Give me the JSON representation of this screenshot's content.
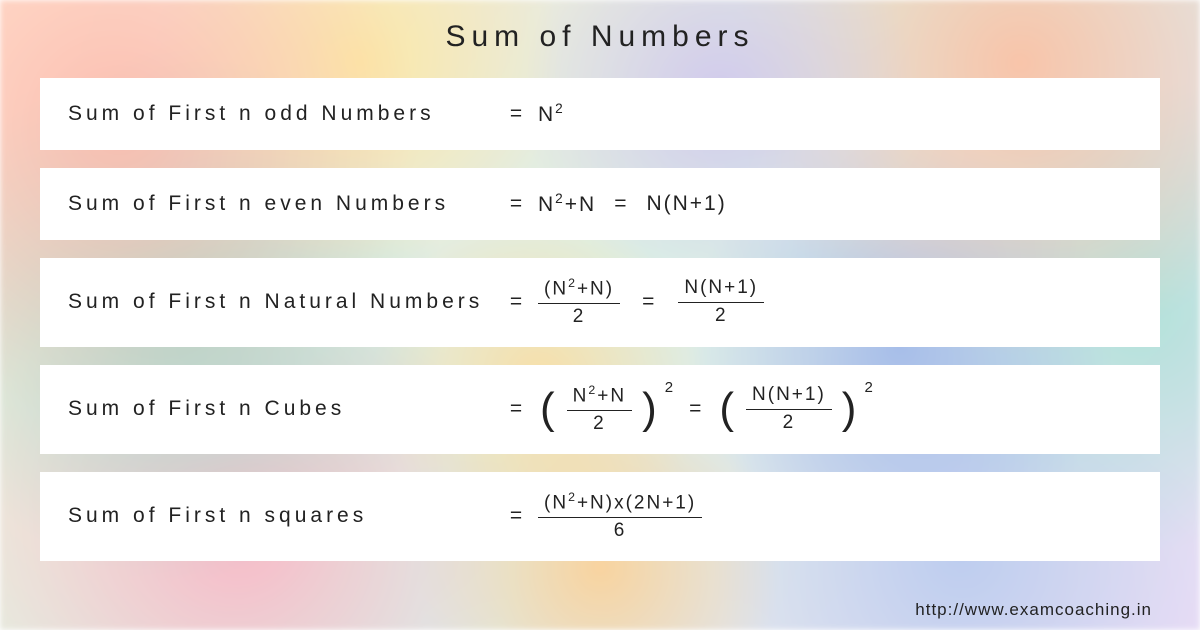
{
  "title": "Sum of Numbers",
  "rows": [
    {
      "label": "Sum of First n odd Numbers"
    },
    {
      "label": "Sum of First n even Numbers"
    },
    {
      "label": "Sum of First n Natural Numbers"
    },
    {
      "label": "Sum of First n Cubes"
    },
    {
      "label": "Sum of First n squares"
    }
  ],
  "formulas": {
    "odd": "N²",
    "even_a": "N²+N",
    "even_b": "N(N+1)",
    "natural_num_a": "(N²+N)",
    "natural_den": "2",
    "natural_num_b": "N(N+1)",
    "cubes_num_a": "N²+N",
    "cubes_den": "2",
    "cubes_num_b": "N(N+1)",
    "cubes_exp": "2",
    "squares_num": "(N²+N)x(2N+1)",
    "squares_den": "6"
  },
  "equals": "=",
  "footer": "http://www.examcoaching.in"
}
